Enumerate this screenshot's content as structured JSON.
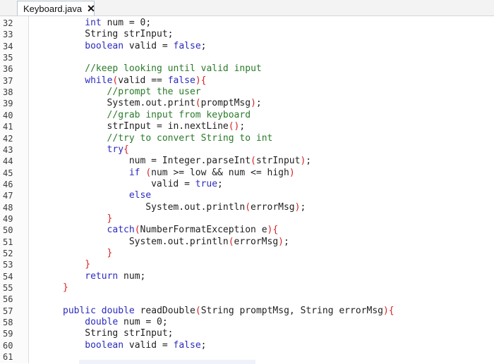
{
  "tab": {
    "title": "Keyboard.java",
    "close_glyph": "✕"
  },
  "lines": [
    {
      "n": "32",
      "indent": 4,
      "tokens": [
        [
          "kw",
          "int"
        ],
        [
          "t",
          " num = "
        ],
        [
          "t",
          "0;"
        ]
      ]
    },
    {
      "n": "33",
      "indent": 4,
      "tokens": [
        [
          "t",
          "String strInput;"
        ]
      ]
    },
    {
      "n": "34",
      "indent": 4,
      "tokens": [
        [
          "kw",
          "boolean"
        ],
        [
          "t",
          " valid = "
        ],
        [
          "kw",
          "false"
        ],
        [
          "t",
          ";"
        ]
      ]
    },
    {
      "n": "35",
      "indent": 0,
      "tokens": []
    },
    {
      "n": "36",
      "indent": 4,
      "tokens": [
        [
          "cm",
          "//keep looking until valid input"
        ]
      ]
    },
    {
      "n": "37",
      "indent": 4,
      "tokens": [
        [
          "kw",
          "while"
        ],
        [
          "br",
          "("
        ],
        [
          "t",
          "valid == "
        ],
        [
          "kw",
          "false"
        ],
        [
          "br",
          ")"
        ],
        [
          "br",
          "{"
        ]
      ]
    },
    {
      "n": "38",
      "indent": 8,
      "tokens": [
        [
          "cm",
          "//prompt the user"
        ]
      ]
    },
    {
      "n": "39",
      "indent": 8,
      "tokens": [
        [
          "t",
          "System.out.print"
        ],
        [
          "br",
          "("
        ],
        [
          "t",
          "promptMsg"
        ],
        [
          "br",
          ")"
        ],
        [
          "t",
          ";"
        ]
      ]
    },
    {
      "n": "40",
      "indent": 8,
      "tokens": [
        [
          "cm",
          "//grab input from keyboard"
        ]
      ]
    },
    {
      "n": "41",
      "indent": 8,
      "tokens": [
        [
          "t",
          "strInput = in.nextLine"
        ],
        [
          "br",
          "()"
        ],
        [
          "t",
          ";"
        ]
      ]
    },
    {
      "n": "42",
      "indent": 8,
      "tokens": [
        [
          "cm",
          "//try to convert String to int"
        ]
      ]
    },
    {
      "n": "43",
      "indent": 8,
      "tokens": [
        [
          "kw",
          "try"
        ],
        [
          "br",
          "{"
        ]
      ]
    },
    {
      "n": "44",
      "indent": 12,
      "tokens": [
        [
          "t",
          "num = Integer.parseInt"
        ],
        [
          "br",
          "("
        ],
        [
          "t",
          "strInput"
        ],
        [
          "br",
          ")"
        ],
        [
          "t",
          ";"
        ]
      ]
    },
    {
      "n": "45",
      "indent": 12,
      "tokens": [
        [
          "kw",
          "if"
        ],
        [
          "t",
          " "
        ],
        [
          "br",
          "("
        ],
        [
          "t",
          "num >= low && num <= high"
        ],
        [
          "br",
          ")"
        ]
      ]
    },
    {
      "n": "46",
      "indent": 16,
      "tokens": [
        [
          "t",
          "valid = "
        ],
        [
          "kw",
          "true"
        ],
        [
          "t",
          ";"
        ]
      ]
    },
    {
      "n": "47",
      "indent": 12,
      "tokens": [
        [
          "kw",
          "else"
        ]
      ]
    },
    {
      "n": "48",
      "indent": 15,
      "tokens": [
        [
          "t",
          "System.out.println"
        ],
        [
          "br",
          "("
        ],
        [
          "t",
          "errorMsg"
        ],
        [
          "br",
          ")"
        ],
        [
          "t",
          ";"
        ]
      ]
    },
    {
      "n": "49",
      "indent": 8,
      "tokens": [
        [
          "br",
          "}"
        ]
      ]
    },
    {
      "n": "50",
      "indent": 8,
      "tokens": [
        [
          "kw",
          "catch"
        ],
        [
          "br",
          "("
        ],
        [
          "t",
          "NumberFormatException e"
        ],
        [
          "br",
          ")"
        ],
        [
          "br",
          "{"
        ]
      ]
    },
    {
      "n": "51",
      "indent": 12,
      "tokens": [
        [
          "t",
          "System.out.println"
        ],
        [
          "br",
          "("
        ],
        [
          "t",
          "errorMsg"
        ],
        [
          "br",
          ")"
        ],
        [
          "t",
          ";"
        ]
      ]
    },
    {
      "n": "52",
      "indent": 8,
      "tokens": [
        [
          "br",
          "}"
        ]
      ]
    },
    {
      "n": "53",
      "indent": 4,
      "tokens": [
        [
          "br",
          "}"
        ]
      ]
    },
    {
      "n": "54",
      "indent": 4,
      "tokens": [
        [
          "kw",
          "return"
        ],
        [
          "t",
          " num;"
        ]
      ]
    },
    {
      "n": "55",
      "indent": 0,
      "tokens": [
        [
          "br",
          "}"
        ]
      ]
    },
    {
      "n": "56",
      "indent": 0,
      "tokens": []
    },
    {
      "n": "57",
      "indent": 0,
      "tokens": [
        [
          "kw",
          "public"
        ],
        [
          "t",
          " "
        ],
        [
          "kw",
          "double"
        ],
        [
          "t",
          " readDouble"
        ],
        [
          "br",
          "("
        ],
        [
          "t",
          "String promptMsg, String errorMsg"
        ],
        [
          "br",
          ")"
        ],
        [
          "br",
          "{"
        ]
      ]
    },
    {
      "n": "58",
      "indent": 4,
      "tokens": [
        [
          "kw",
          "double"
        ],
        [
          "t",
          " num = 0;"
        ]
      ]
    },
    {
      "n": "59",
      "indent": 4,
      "tokens": [
        [
          "t",
          "String strInput;"
        ]
      ]
    },
    {
      "n": "60",
      "indent": 4,
      "tokens": [
        [
          "kw",
          "boolean"
        ],
        [
          "t",
          " valid = "
        ],
        [
          "kw",
          "false"
        ],
        [
          "t",
          ";"
        ]
      ]
    },
    {
      "n": "61",
      "indent": 0,
      "tokens": []
    }
  ]
}
